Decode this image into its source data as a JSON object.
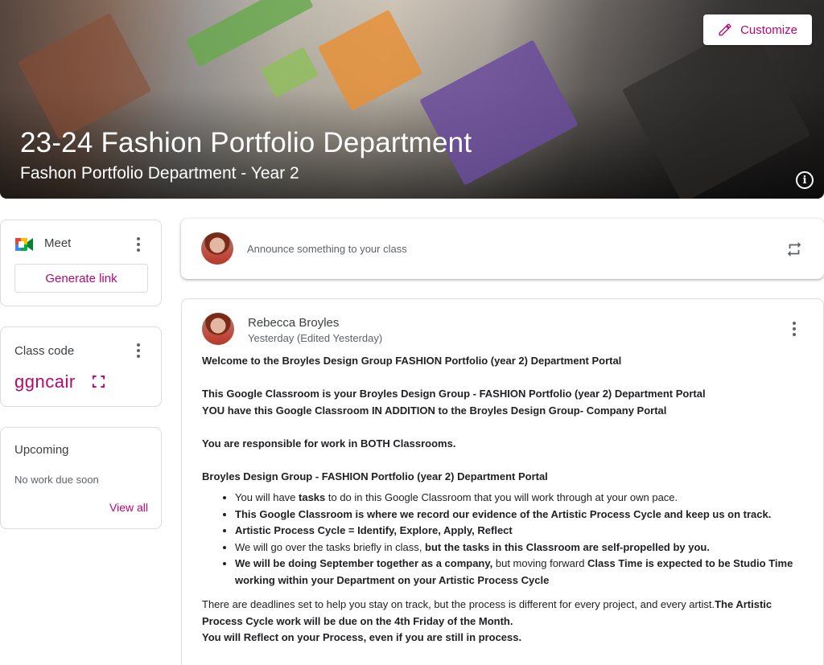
{
  "banner": {
    "title": "23-24 Fashion Portfolio Department",
    "subtitle": "Fashon Portfolio Department - Year 2",
    "customize_label": "Customize",
    "info_icon": "info-icon"
  },
  "meet": {
    "label": "Meet",
    "generate_link_label": "Generate link"
  },
  "class_code": {
    "label": "Class code",
    "value": "ggncair"
  },
  "upcoming": {
    "label": "Upcoming",
    "empty_text": "No work due soon",
    "view_all_label": "View all"
  },
  "announce": {
    "placeholder": "Announce something to your class"
  },
  "post": {
    "author": "Rebecca Broyles",
    "timestamp": "Yesterday (Edited Yesterday)",
    "p1": "Welcome to the Broyles Design Group FASHION Portfolio (year 2) Department Portal",
    "p2a": "This Google Classroom is your Broyles Design Group - FASHION Portfolio (year 2)  Department Portal",
    "p2b": "YOU have this Google Classroom IN ADDITION to the Broyles Design Group- Company Portal",
    "p3": "You are responsible for work in BOTH Classrooms.",
    "p4": "Broyles Design Group - FASHION Portfolio (year 2) Department Portal",
    "b1_pre": "You will have ",
    "b1_bold": "tasks",
    "b1_post": " to do in this Google Classroom that you will work through at your own pace.",
    "b2": "This Google Classroom is where we record our evidence of the Artistic Process Cycle and keep us on track.",
    "b3": "Artistic Process Cycle = Identify, Explore, Apply, Reflect",
    "b4_pre": "We will go over the tasks briefly in class, ",
    "b4_bold": "but the tasks in this Classroom are self-propelled by you.",
    "b5_bold1": "We will be doing September together as a company,",
    "b5_mid": " but moving forward ",
    "b5_bold2": "Class Time is expected to be Studio Time working within your Department on your Artistic Process Cycle",
    "p5_pre": "There are deadlines set to help you stay on track, but the process is different for every project, and every artist.",
    "p5_bold": "The Artistic Process Cycle work will be due on the 4th Friday of the Month.",
    "p6": "You will Reflect on your Process, even if you are still in process."
  },
  "colors": {
    "accent": "#b80672",
    "text": "#3c4043",
    "muted": "#5f6368",
    "border": "#dadce0"
  },
  "icons": [
    "edit-pencil-icon",
    "info-icon",
    "google-meet-icon",
    "more-vert-icon",
    "expand-fullscreen-icon",
    "repost-icon"
  ]
}
